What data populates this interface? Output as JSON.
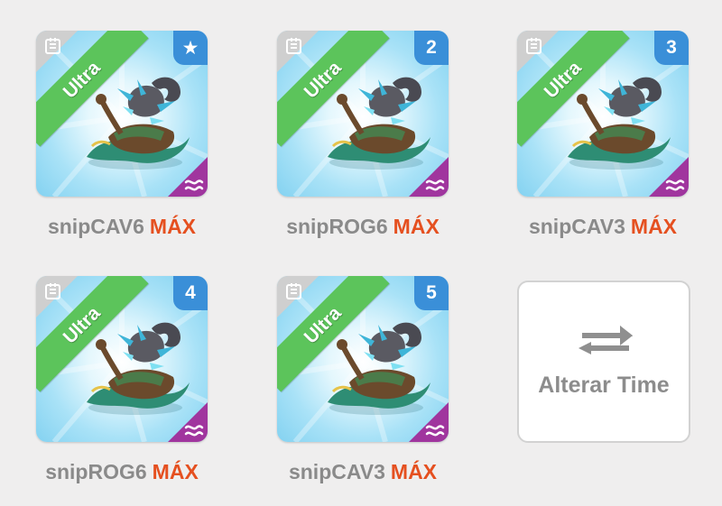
{
  "team": [
    {
      "name": "snipCAV6",
      "level": "MÁX",
      "rarity": "Ultra",
      "badge": "star",
      "badge_text": "★",
      "element": "water-wave-icon"
    },
    {
      "name": "snipROG6",
      "level": "MÁX",
      "rarity": "Ultra",
      "badge": "number",
      "badge_text": "2",
      "element": "water-wave-icon"
    },
    {
      "name": "snipCAV3",
      "level": "MÁX",
      "rarity": "Ultra",
      "badge": "number",
      "badge_text": "3",
      "element": "water-wave-icon"
    },
    {
      "name": "snipROG6",
      "level": "MÁX",
      "rarity": "Ultra",
      "badge": "number",
      "badge_text": "4",
      "element": "water-wave-icon"
    },
    {
      "name": "snipCAV3",
      "level": "MÁX",
      "rarity": "Ultra",
      "badge": "number",
      "badge_text": "5",
      "element": "water-wave-icon"
    }
  ],
  "switch_team": {
    "label": "Alterar Time",
    "icon": "swap-arrows-icon"
  },
  "colors": {
    "background": "#efeeee",
    "ultra_ribbon": "#5cc45b",
    "badge": "#3a8fd8",
    "element_tag": "#a0359e",
    "max_label": "#e55020",
    "name_label": "#8a8a8a"
  }
}
